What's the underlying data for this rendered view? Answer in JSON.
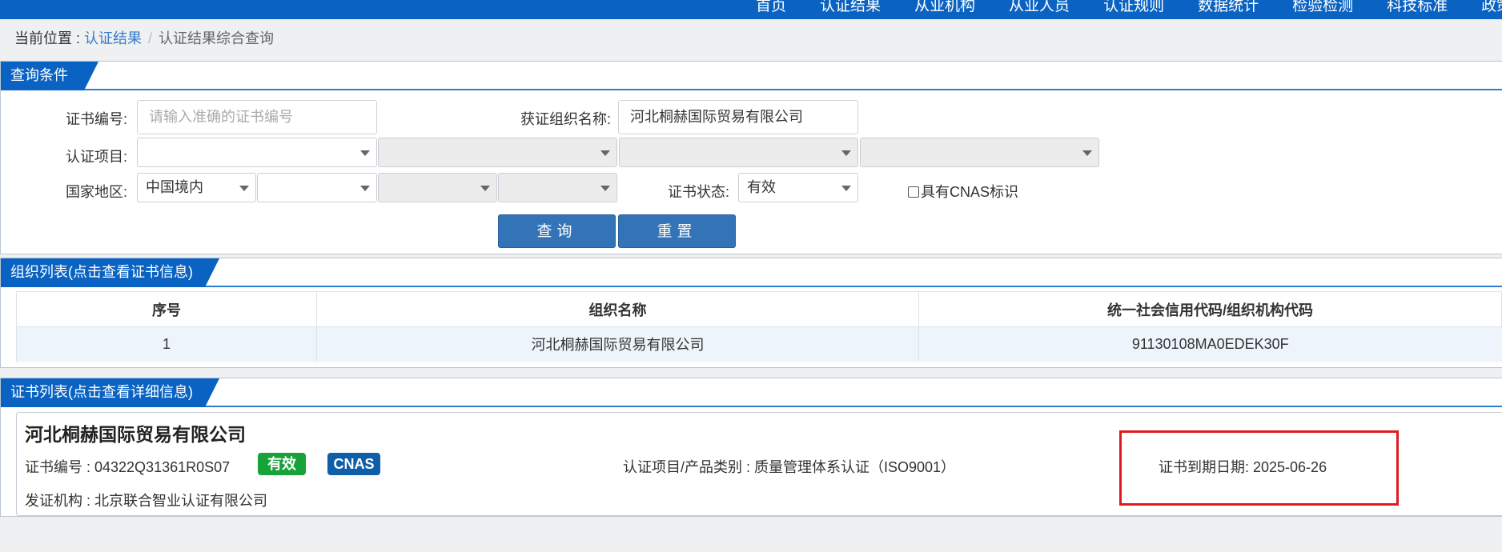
{
  "nav": {
    "items": [
      "首页",
      "认证结果",
      "从业机构",
      "从业人员",
      "认证规则",
      "数据统计",
      "检验检测",
      "科技标准",
      "政策法"
    ]
  },
  "breadcrumb": {
    "prefix": "当前位置 : ",
    "link": "认证结果",
    "separator": "/",
    "current": "认证结果综合查询"
  },
  "query": {
    "tab": "查询条件",
    "cert_no_label": "证书编号:",
    "cert_no_placeholder": "请输入准确的证书编号",
    "org_name_label": "获证组织名称:",
    "org_name_value": "河北桐赫国际贸易有限公司",
    "project_label": "认证项目:",
    "region_label": "国家地区:",
    "region_value": "中国境内",
    "status_label": "证书状态:",
    "status_value": "有效",
    "cnas_label": "具有CNAS标识",
    "search_button": "查询",
    "reset_button": "重置"
  },
  "org_list": {
    "tab": "组织列表(点击查看证书信息)",
    "columns": [
      "序号",
      "组织名称",
      "统一社会信用代码/组织机构代码"
    ],
    "rows": [
      [
        "1",
        "河北桐赫国际贸易有限公司",
        "91130108MA0EDEK30F"
      ]
    ]
  },
  "cert_list": {
    "tab": "证书列表(点击查看详细信息)",
    "card": {
      "org_name": "河北桐赫国际贸易有限公司",
      "cert_no": "证书编号 : 04322Q31361R0S07",
      "status_badge": "有效",
      "cnas_badge": "CNAS",
      "project": "认证项目/产品类别 : 质量管理体系认证（ISO9001）",
      "expiry": "证书到期日期: 2025-06-26",
      "issuer": "发证机构 : 北京联合智业认证有限公司"
    }
  },
  "colors": {
    "brand_blue": "#0a63c2",
    "button_blue": "#3374b8",
    "badge_green": "#18a23a",
    "badge_blue": "#0f5fa8",
    "highlight_red": "#e0191f"
  }
}
